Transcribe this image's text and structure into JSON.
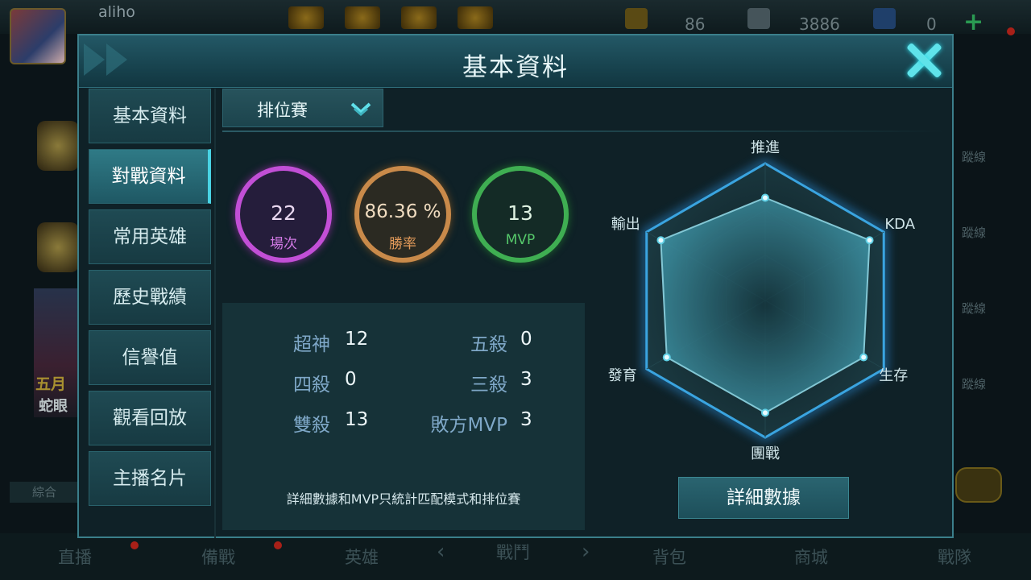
{
  "background": {
    "username": "aliho",
    "resources": [
      {
        "icon": "card-icon",
        "value": "86"
      },
      {
        "icon": "swords-icon",
        "value": "3886"
      },
      {
        "icon": "gem-icon",
        "value": "0"
      }
    ],
    "left_text_1": "五月",
    "left_text_2": "蛇眼",
    "right_labels": [
      "蹤線",
      "蹤線",
      "蹤線",
      "蹤線"
    ],
    "zonghe": "綜合",
    "nav": [
      "直播",
      "備戰",
      "英雄",
      "戰鬥",
      "背包",
      "商城",
      "戰隊"
    ]
  },
  "modal": {
    "title": "基本資料",
    "sidebar": [
      {
        "label": "基本資料",
        "active": false
      },
      {
        "label": "對戰資料",
        "active": true
      },
      {
        "label": "常用英雄",
        "active": false
      },
      {
        "label": "歷史戰績",
        "active": false
      },
      {
        "label": "信譽值",
        "active": false
      },
      {
        "label": "觀看回放",
        "active": false
      },
      {
        "label": "主播名片",
        "active": false
      }
    ],
    "mode_select": {
      "label": "排位賽"
    },
    "stats": {
      "matches": {
        "value": "22",
        "label": "場次",
        "color": "#c24fd6"
      },
      "win_rate": {
        "value": "86.36 %",
        "label": "勝率",
        "color": "#c98a4a"
      },
      "mvp": {
        "value": "13",
        "label": "MVP",
        "color": "#3fae52"
      }
    },
    "records": [
      {
        "label": "超神",
        "value": "12"
      },
      {
        "label": "五殺",
        "value": "0"
      },
      {
        "label": "四殺",
        "value": "0"
      },
      {
        "label": "三殺",
        "value": "3"
      },
      {
        "label": "雙殺",
        "value": "13"
      },
      {
        "label": "敗方MVP",
        "value": "3"
      }
    ],
    "footnote": "詳細數據和MVP只統計匹配模式和排位賽",
    "radar": {
      "axes": [
        "推進",
        "KDA",
        "生存",
        "團戰",
        "發育",
        "輸出"
      ],
      "values": [
        0.75,
        0.88,
        0.83,
        0.82,
        0.83,
        0.88
      ]
    },
    "detail_button": "詳細數據"
  },
  "colors": {
    "accent": "#49d4e4",
    "panel": "#163238",
    "header": "#1c4a55"
  }
}
